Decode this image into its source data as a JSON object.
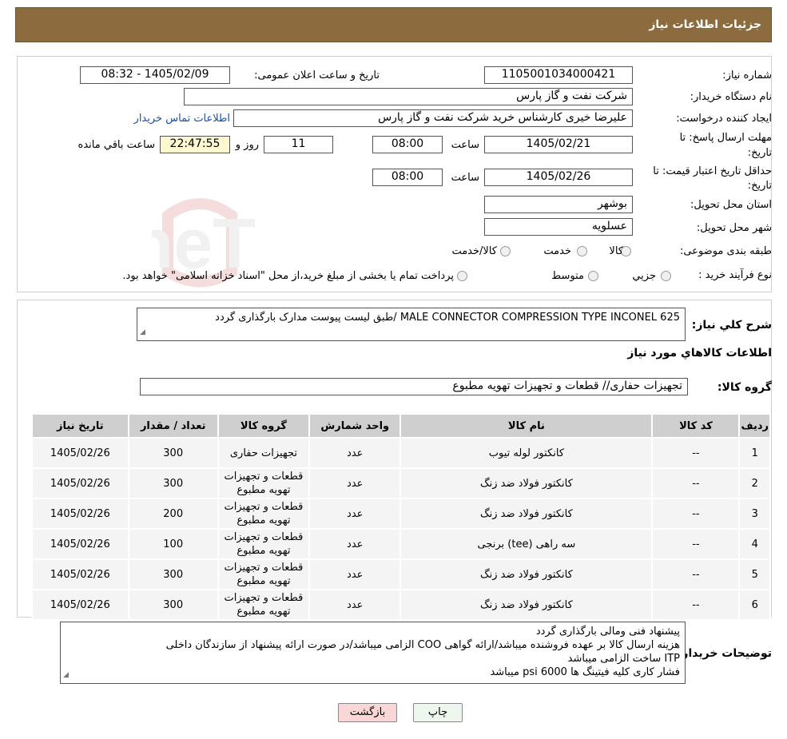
{
  "header": {
    "title": "جزئیات اطلاعات نیاز"
  },
  "form": {
    "need_number_label": "شماره نیاز:",
    "need_number": "1105001034000421",
    "announce_label": "تاریخ و ساعت اعلان عمومی:",
    "announce_value": "1405/02/09 - 08:32",
    "buyer_org_label": "نام دستگاه خریدار:",
    "buyer_org": "شرکت نفت و گاز پارس",
    "creator_label": "ایجاد کننده درخواست:",
    "creator": "علیرضا  خیری کارشناس خرید  شرکت نفت و گاز پارس",
    "contact_link": "اطلاعات تماس خریدار",
    "deadline_label_1": "مهلت ارسال پاسخ: تا",
    "deadline_label_2": "تاریخ:",
    "deadline_date": "1405/02/21",
    "time_label": "ساعت",
    "deadline_time": "08:00",
    "days_value": "11",
    "days_label": "روز و",
    "remaining_time": "22:47:55",
    "remaining_label": "ساعت باقي مانده",
    "validity_label_1": "حداقل تاریخ اعتبار قیمت: تا",
    "validity_label_2": "تاریخ:",
    "validity_date": "1405/02/26",
    "validity_time": "08:00",
    "province_label": "استان محل تحویل:",
    "province": "بوشهر",
    "city_label": "شهر محل تحویل:",
    "city": "عسلویه",
    "category_label": "طبقه بندی موضوعی:",
    "category_options": [
      "کالا",
      "خدمت",
      "کالا/خدمت"
    ],
    "process_label": "نوع فرآیند خرید :",
    "process_options": [
      "جزیي",
      "متوسط"
    ],
    "process_note": "پرداخت تمام یا بخشی از مبلغ خرید،از محل \"اسناد خزانه اسلامی\" خواهد بود."
  },
  "details": {
    "summary_label": "شرح كلي نياز:",
    "summary": "MALE CONNECTOR COMPRESSION TYPE INCONEL 625 /طبق لیست پیوست مدارک بارگذاری گردد",
    "goods_info_title": "اطلاعات کالاهاي مورد نياز",
    "goods_group_label": "گروه کالا:",
    "goods_group": "تجهیزات حفاری//  قطعات و تجهیزات تهویه مطبوع"
  },
  "table": {
    "headers": [
      "رديف",
      "کد کالا",
      "نام کالا",
      "واحد شمارش",
      "گروه کالا",
      "تعداد / مقدار",
      "تاریخ نیاز"
    ],
    "rows": [
      {
        "row": "1",
        "code": "--",
        "name": "کانکتور لوله تیوب",
        "unit": "عدد",
        "group": "تجهیزات حفاری",
        "qty": "300",
        "date": "1405/02/26"
      },
      {
        "row": "2",
        "code": "--",
        "name": "کانکتور فولاد ضد زنگ",
        "unit": "عدد",
        "group": "قطعات و تجهیزات تهویه مطبوع",
        "qty": "300",
        "date": "1405/02/26"
      },
      {
        "row": "3",
        "code": "--",
        "name": "کانکتور فولاد ضد زنگ",
        "unit": "عدد",
        "group": "قطعات و تجهیزات تهویه مطبوع",
        "qty": "200",
        "date": "1405/02/26"
      },
      {
        "row": "4",
        "code": "--",
        "name": "سه راهی (tee) برنجی",
        "unit": "عدد",
        "group": "قطعات و تجهیزات تهویه مطبوع",
        "qty": "100",
        "date": "1405/02/26"
      },
      {
        "row": "5",
        "code": "--",
        "name": "کانکتور فولاد ضد زنگ",
        "unit": "عدد",
        "group": "قطعات و تجهیزات تهویه مطبوع",
        "qty": "300",
        "date": "1405/02/26"
      },
      {
        "row": "6",
        "code": "--",
        "name": "کانکتور فولاد ضد زنگ",
        "unit": "عدد",
        "group": "قطعات و تجهیزات تهویه مطبوع",
        "qty": "300",
        "date": "1405/02/26"
      }
    ]
  },
  "buyer_notes": {
    "label": "توضیحات خریدار:",
    "lines": [
      "پیشنهاد فنی ومالی بارگذاری گردد",
      "هزینه ارسال کالا بر عهده فروشنده میباشد/ارائه گواهی COO الزامی میباشد/در صورت ارائه پیشنهاد از سازندگان داخلی",
      "ITP ساخت الزامی میباشد",
      "فشار کاری کلیه فیتینگ ها psi 6000 میباشد"
    ]
  },
  "buttons": {
    "print": "چاپ",
    "back": "بازگشت"
  },
  "colors": {
    "header_bg": "#8c6b3f",
    "back_bg": "#f9d7d7",
    "print_bg": "#eef7ee"
  }
}
